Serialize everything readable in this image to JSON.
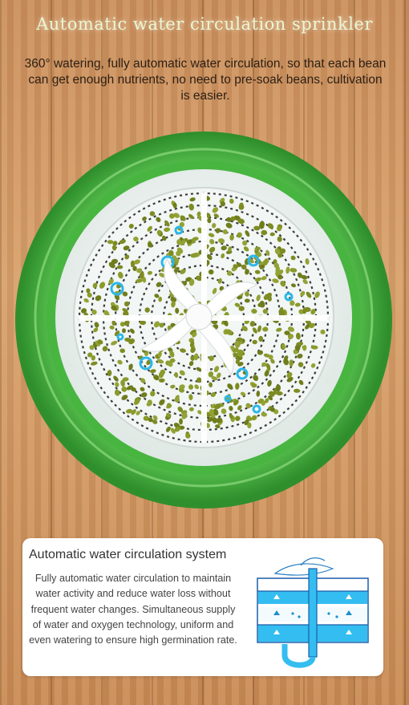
{
  "header": {
    "title": "Automatic water circulation sprinkler",
    "description": "360° watering, fully automatic water circulation, so that each bean can get enough nutrients, no need to pre-soak beans, cultivation is easier."
  },
  "info_panel": {
    "title": "Automatic water circulation system",
    "body": "Fully automatic water circulation to maintain water activity and reduce water loss without frequent water changes. Simultaneous supply of water and oxygen technology, uniform and even watering to ensure high germination rate."
  },
  "colors": {
    "rim_green": "#3fae3a",
    "bean_green": "#7d8b22",
    "water_blue": "#2bb7ea",
    "wood": "#d19a64"
  }
}
